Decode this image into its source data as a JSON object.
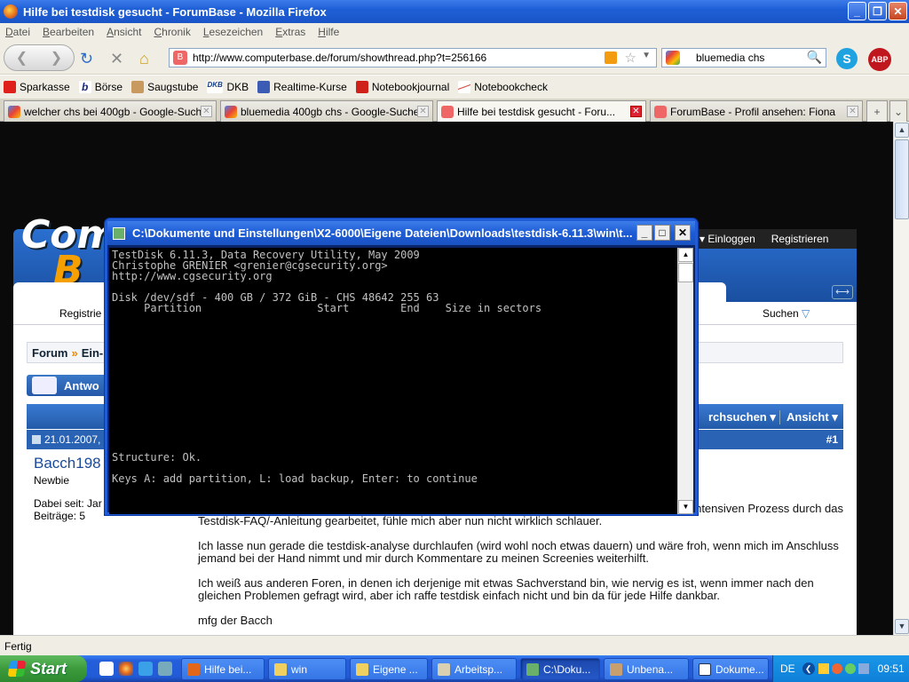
{
  "window": {
    "title": "Hilfe bei testdisk gesucht - ForumBase - Mozilla Firefox"
  },
  "menu": [
    "Datei",
    "Bearbeiten",
    "Ansicht",
    "Chronik",
    "Lesezeichen",
    "Extras",
    "Hilfe"
  ],
  "nav": {
    "url": "http://www.computerbase.de/forum/showthread.php?t=256166",
    "search_value": "bluemedia chs"
  },
  "bookmarks": [
    "Sparkasse",
    "Börse",
    "Saugstube",
    "DKB",
    "Realtime-Kurse",
    "Notebookjournal",
    "Notebookcheck"
  ],
  "bookmark_icon_text": {
    "dkb": "DKB"
  },
  "tabs": [
    {
      "label": "welcher chs bei 400gb - Google-Suche"
    },
    {
      "label": "bluemedia 400gb chs - Google-Suche"
    },
    {
      "label": "Hilfe bei testdisk gesucht - Foru..."
    },
    {
      "label": "ForumBase - Profil ansehen: Fiona"
    }
  ],
  "site": {
    "topnav": {
      "login": "Einloggen",
      "register": "Registrieren"
    },
    "subnav": {
      "left": "Registrie",
      "search": "Suchen"
    },
    "breadcrumb": {
      "forum": "Forum",
      "sep": "»",
      "next": "Ein-"
    },
    "reply_button": "Antwo",
    "thread_tools": {
      "search": "rchsuchen",
      "view": "Ansicht"
    },
    "post": {
      "date": "21.01.2007,",
      "number": "#1"
    },
    "user": {
      "name": "Bacch198",
      "rank": "Newbie",
      "joined": "Dabei seit: Jar",
      "posts": "Beiträge: 5"
    },
    "post_body": [
      "einiger Zeit der Suche bin ich hier gelandet und habe mich in einem nervenaufreibenden und zeitintensiven Prozess durch das Testdisk-FAQ/-Anleitung gearbeitet, fühle mich aber nun nicht wirklich schlauer.",
      "Ich lasse nun gerade die testdisk-analyse durchlaufen (wird wohl noch etwas dauern) und wäre froh, wenn mich im Anschluss jemand bei der Hand nimmt und mir durch Kommentare zu meinen Screenies weiterhilft.",
      "Ich weiß aus anderen Foren, in denen ich derjenige mit etwas Sachverstand bin, wie nervig es ist, wenn immer nach den gleichen Problemen gefragt wird, aber ich raffe testdisk einfach nicht und bin da für jede Hilfe dankbar.",
      "mfg der Bacch"
    ]
  },
  "console": {
    "title": "C:\\Dokumente und Einstellungen\\X2-6000\\Eigene Dateien\\Downloads\\testdisk-6.11.3\\win\\t...",
    "lines": [
      "TestDisk 6.11.3, Data Recovery Utility, May 2009",
      "Christophe GRENIER <grenier@cgsecurity.org>",
      "http://www.cgsecurity.org",
      "",
      "Disk /dev/sdf - 400 GB / 372 GiB - CHS 48642 255 63",
      "     Partition                  Start        End    Size in sectors",
      "",
      "",
      "",
      "",
      "",
      "",
      "",
      "",
      "",
      "",
      "",
      "",
      "",
      "Structure: Ok.",
      "",
      "Keys A: add partition, L: load backup, Enter: to continue"
    ]
  },
  "status": {
    "text": "Fertig"
  },
  "taskbar": {
    "start": "Start",
    "tasks": [
      "Hilfe bei...",
      "win",
      "Eigene ...",
      "Arbeitsp...",
      "C:\\Doku...",
      "Unbena...",
      "Dokume..."
    ],
    "lang": "DE",
    "clock": "09:51"
  }
}
